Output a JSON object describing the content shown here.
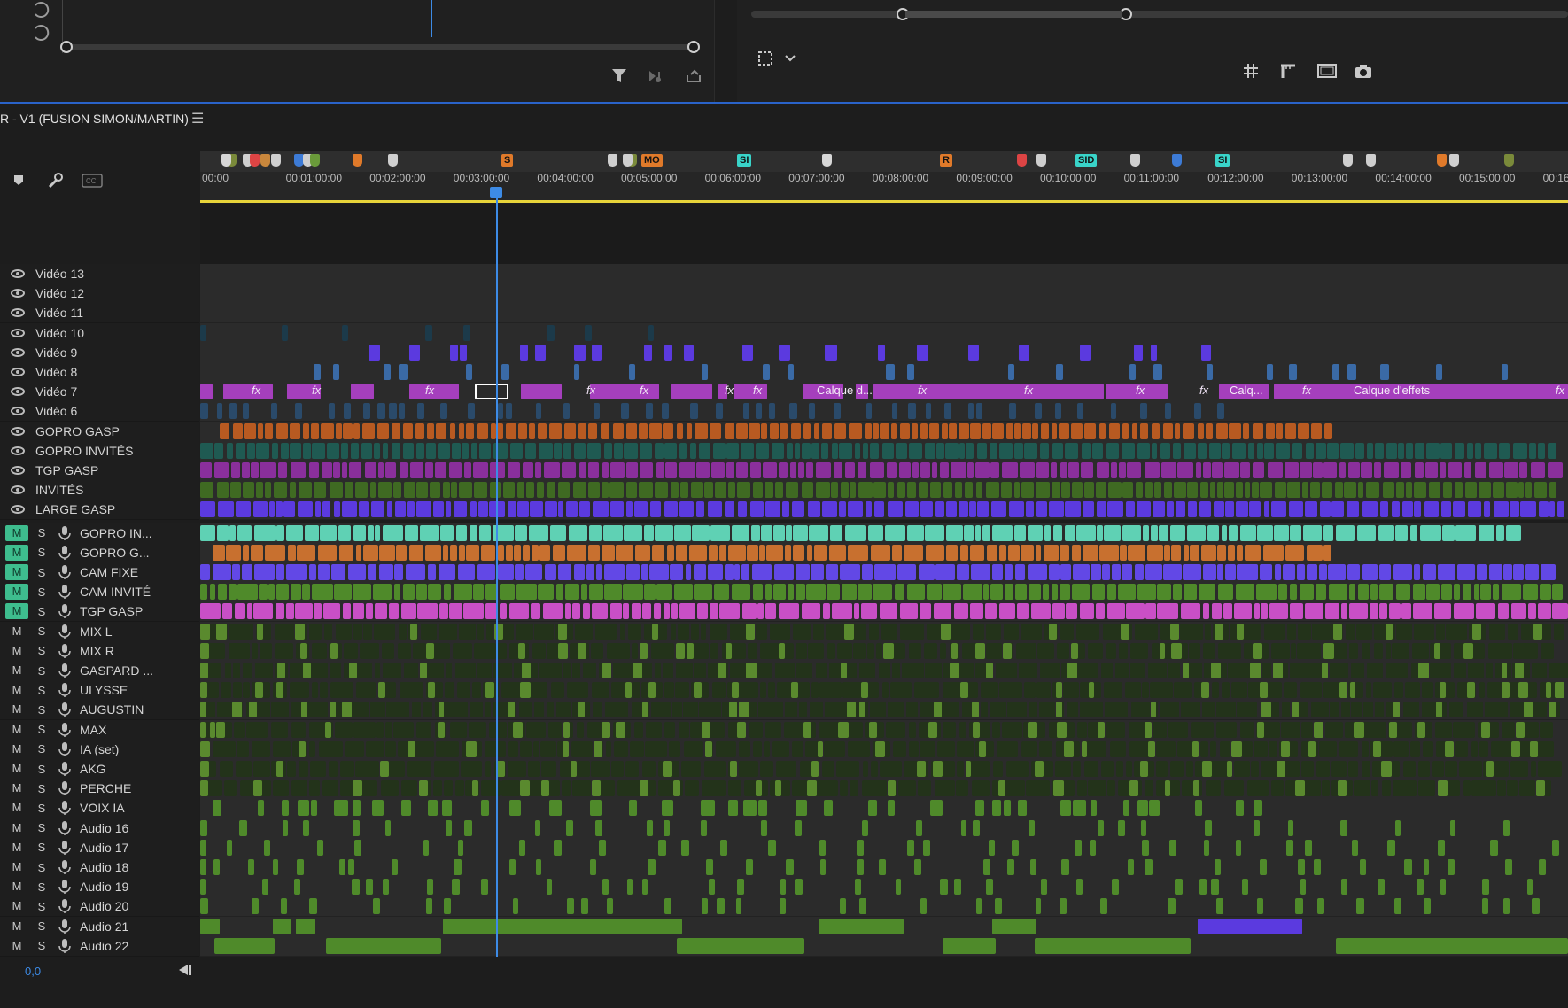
{
  "sequence": {
    "title": "R - V1 (FUSION SIMON/MARTIN)",
    "menu_icon": "hamburger-menu-icon"
  },
  "top_left_panel": {
    "icons": [
      "undo-icon",
      "undo-icon",
      "filter-icon",
      "insert-audio-icon",
      "export-icon"
    ]
  },
  "top_right_panel": {
    "icons": [
      "safe-margins-icon",
      "chevron-down-icon",
      "grid-icon",
      "ruler-guides-icon",
      "frame-icon",
      "camera-icon"
    ]
  },
  "timeline_tools": {
    "icons": [
      "marker-icon",
      "wrench-icon",
      "captions-icon"
    ]
  },
  "ruler": {
    "timecodes": [
      "00:00",
      "00:01:00:00",
      "00:02:00:00",
      "00:03:00:00",
      "00:04:00:00",
      "00:05:00:00",
      "00:06:00:00",
      "00:07:00:00",
      "00:08:00:00",
      "00:09:00:00",
      "00:10:00:00",
      "00:11:00:00",
      "00:12:00:00",
      "00:13:00:00",
      "00:14:00:00",
      "00:15:00:00",
      "00:16:00"
    ],
    "marker_labels": [
      "S",
      "MO",
      "SI",
      "R",
      "SID",
      "SI"
    ]
  },
  "video_tracks": [
    "Vidéo 13",
    "Vidéo 12",
    "Vidéo 11",
    "Vidéo 10",
    "Vidéo 9",
    "Vidéo 8",
    "Vidéo 7",
    "Vidéo 6",
    "GOPRO GASP",
    "GOPRO INVITÉS",
    "TGP GASP",
    "INVITÉS",
    "LARGE GASP"
  ],
  "audio_tracks": [
    {
      "name": "GOPRO IN...",
      "mute": "M",
      "solo": "S",
      "mute_on": true
    },
    {
      "name": "GOPRO G...",
      "mute": "M",
      "solo": "S",
      "mute_on": true
    },
    {
      "name": "CAM FIXE",
      "mute": "M",
      "solo": "S",
      "mute_on": true
    },
    {
      "name": "CAM INVITÉ",
      "mute": "M",
      "solo": "S",
      "mute_on": true
    },
    {
      "name": "TGP GASP",
      "mute": "M",
      "solo": "S",
      "mute_on": true
    },
    {
      "name": "MIX L",
      "mute": "M",
      "solo": "S",
      "mute_on": false
    },
    {
      "name": "MIX R",
      "mute": "M",
      "solo": "S",
      "mute_on": false
    },
    {
      "name": "GASPARD ...",
      "mute": "M",
      "solo": "S",
      "mute_on": false
    },
    {
      "name": "ULYSSE",
      "mute": "M",
      "solo": "S",
      "mute_on": false
    },
    {
      "name": "AUGUSTIN",
      "mute": "M",
      "solo": "S",
      "mute_on": false
    },
    {
      "name": "MAX",
      "mute": "M",
      "solo": "S",
      "mute_on": false
    },
    {
      "name": "IA (set)",
      "mute": "M",
      "solo": "S",
      "mute_on": false
    },
    {
      "name": "AKG",
      "mute": "M",
      "solo": "S",
      "mute_on": false
    },
    {
      "name": "PERCHE",
      "mute": "M",
      "solo": "S",
      "mute_on": false
    },
    {
      "name": "VOIX IA",
      "mute": "M",
      "solo": "S",
      "mute_on": false
    },
    {
      "name": "Audio 16",
      "mute": "M",
      "solo": "S",
      "mute_on": false
    },
    {
      "name": "Audio 17",
      "mute": "M",
      "solo": "S",
      "mute_on": false
    },
    {
      "name": "Audio 18",
      "mute": "M",
      "solo": "S",
      "mute_on": false
    },
    {
      "name": "Audio 19",
      "mute": "M",
      "solo": "S",
      "mute_on": false
    },
    {
      "name": "Audio 20",
      "mute": "M",
      "solo": "S",
      "mute_on": false
    },
    {
      "name": "Audio 21",
      "mute": "M",
      "solo": "S",
      "mute_on": false
    },
    {
      "name": "Audio 22",
      "mute": "M",
      "solo": "S",
      "mute_on": false
    }
  ],
  "clip_labels": {
    "fx": "fx",
    "adjustment_short": "Calque d...",
    "adjustment_shorter": "Calq...",
    "adjustment_full": "Calque d'effets"
  },
  "footer": {
    "zoom_value": "0,0",
    "zoom_icon": "zoom-end-icon"
  },
  "colors": {
    "purple_clip": "#a53fbd",
    "violet_clip": "#5b3adf",
    "orange_clip": "#b85a21",
    "teal_clip": "#5fd1b4",
    "green_clip": "#4f8a2a",
    "light_green_wave": "#d9f39a",
    "pink_clip": "#c94fc6",
    "playhead": "#3d8be6",
    "mute_on": "#3ebd8e"
  }
}
